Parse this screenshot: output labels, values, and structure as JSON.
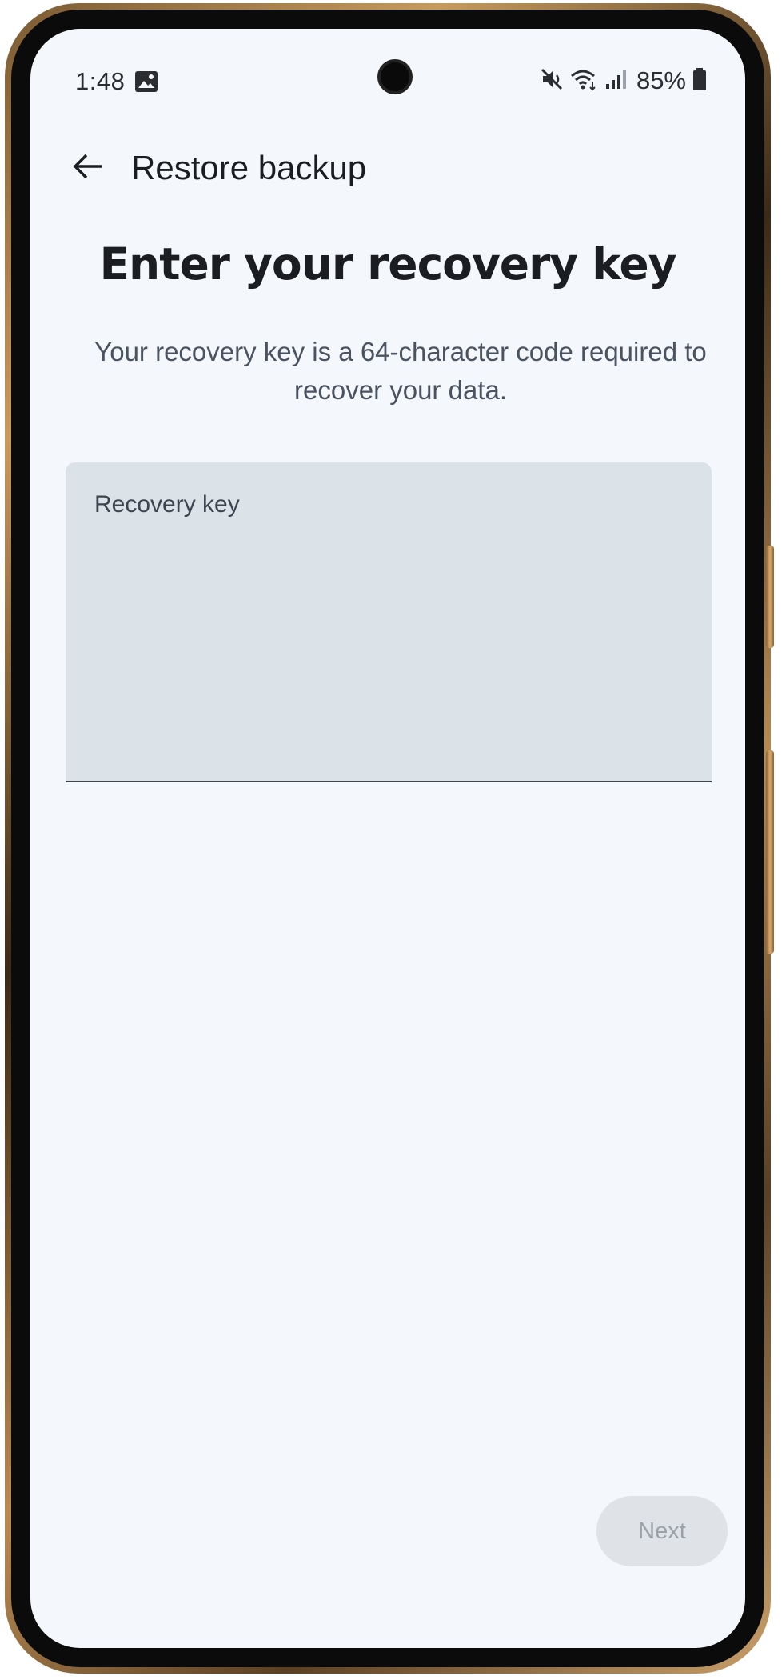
{
  "status_bar": {
    "time": "1:48",
    "battery": "85%",
    "icons": [
      "gallery-icon",
      "mute-icon",
      "wifi-icon",
      "signal-icon",
      "battery-icon"
    ]
  },
  "app_bar": {
    "title": "Restore backup",
    "back_icon": "arrow-back-icon"
  },
  "headline": "Enter your recovery key",
  "description": "Your recovery key is a 64-character code required to recover your data.",
  "recovery_field": {
    "label": "Recovery key",
    "value": ""
  },
  "next_button": {
    "label": "Next",
    "enabled": false
  },
  "colors": {
    "background": "#f4f7fc",
    "field_fill": "#dbe2e8",
    "disabled_button": "#dfe3e8",
    "disabled_text": "#9aa1a9",
    "body_text": "#4a5360"
  }
}
